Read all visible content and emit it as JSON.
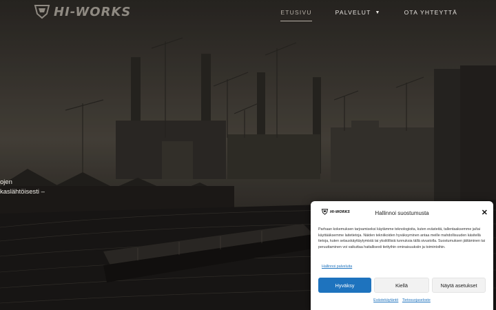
{
  "header": {
    "logo_text": "HI-WORKS",
    "nav": [
      {
        "label": "ETUSIVU",
        "active": true
      },
      {
        "label": "PALVELUT",
        "dropdown": true
      },
      {
        "label": "OTA YHTEYTTÄ"
      }
    ]
  },
  "hero": {
    "line1": "ojen",
    "line2": "kaslähtöisesti –"
  },
  "cookie": {
    "logo_text": "HI-WORKS",
    "title": "Hallinnoi suostumusta",
    "body": "Parhaan kokemuksen tarjoamiseksi käytämme teknologioita, kuten evästeitä, tallentaaksemme ja/tai käyttääksemme laitetietoja. Näiden tekniikoiden hyväksyminen antaa meille mahdollisuuden käsitellä tietoja, kuten selauskäyttäytymistä tai yksilöllisiä tunnuksia tällä sivustolla. Suostumuksen jättäminen tai peruuttaminen voi vaikuttaa haitallisesti tiettyihin ominaisuuksiin ja toimintoihin.",
    "manage_link": "Hallinnoi palveluita",
    "accept": "Hyväksy",
    "deny": "Kiellä",
    "preferences": "Näytä asetukset",
    "cookie_policy": "Evästekäytäntö",
    "privacy_policy": "Tietosuojaseloste",
    "accent_color": "#1e73be"
  }
}
